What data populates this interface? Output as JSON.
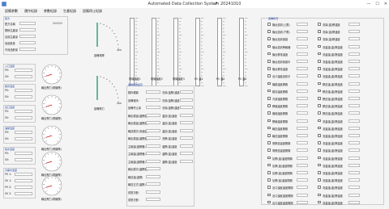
{
  "window": {
    "title": "Automated Data Collection System 20241010",
    "minimize": "—",
    "maximize": "☐",
    "close": "✕"
  },
  "menu": [
    {
      "label": "設備參數"
    },
    {
      "label": "運作紀錄"
    },
    {
      "label": "參數紀錄"
    },
    {
      "label": "生產紀錄"
    },
    {
      "label": "設備停止紀錄"
    }
  ],
  "top_group": {
    "title": "配方",
    "rows": [
      {
        "label": "配方名稱"
      },
      {
        "label": "累積生產量"
      },
      {
        "label": "目前生產量"
      },
      {
        "label": "良品數量"
      },
      {
        "label": "不良品數量"
      }
    ],
    "sample_value": "000000"
  },
  "left_groups": [
    {
      "title": "入口溫度",
      "rows": [
        {
          "label": "PV:"
        },
        {
          "label": "SV:"
        }
      ]
    },
    {
      "title": "模具溫度",
      "rows": [
        {
          "label": "PV:"
        },
        {
          "label": "SV:"
        }
      ]
    },
    {
      "title": "出口溫度",
      "rows": [
        {
          "label": "PV:"
        },
        {
          "label": "SV:"
        }
      ]
    },
    {
      "title": "油壓溫度",
      "rows": [
        {
          "label": "PV:"
        },
        {
          "label": "SV:"
        }
      ]
    },
    {
      "title": "噴水溫度",
      "rows": [
        {
          "label": "PV:"
        },
        {
          "label": "SV:"
        }
      ]
    },
    {
      "title": "冷卻水溫度",
      "rows": [
        {
          "label": "PV 1:"
        },
        {
          "label": "SV 1:"
        },
        {
          "label": "PV 2:"
        },
        {
          "label": "SV 2:"
        }
      ]
    }
  ],
  "gauges": [
    {
      "label": "輸出壓力(電機壓)",
      "level": 0.1
    },
    {
      "label": "輸出壓力(電機壓)",
      "level": 0.1
    },
    {
      "label": "輸出壓力(電機壓)",
      "level": 0.1
    },
    {
      "label": "輸出壓力(電機壓)",
      "level": 0.1
    },
    {
      "label": "輸出壓力(電機壓)",
      "level": 0.1
    }
  ],
  "dials": [
    {
      "label": "設備電壓",
      "max": "400"
    },
    {
      "label": "設備壓力",
      "max": "400"
    }
  ],
  "bars": [
    {
      "label": "電機溫度1"
    },
    {
      "label": "電機溫度2"
    },
    {
      "label": "電機溫度3"
    },
    {
      "label": "PV 溫1"
    },
    {
      "label": "PV 溫2"
    },
    {
      "label": "PV 溫3"
    }
  ],
  "params": {
    "title": "運轉參數設定",
    "left": [
      {
        "label": "模料種類"
      },
      {
        "label": "設備程序:"
      },
      {
        "label": "設備停止量"
      },
      {
        "label": "輸出模溫(溫壓器)"
      },
      {
        "label": "輸出模溫(溫壓器)"
      },
      {
        "label": "輸送模次(流速度)"
      },
      {
        "label": "輸出模溫(溫壓器)"
      },
      {
        "label": "主軸溫(溫壓器)"
      },
      {
        "label": "主軸溫(溫壓器)"
      },
      {
        "label": "主軸溫(溫壓器)"
      },
      {
        "label": "輸出模次(溫壓器)"
      },
      {
        "label": "輸送溫(溫壓)"
      },
      {
        "label": "輸送正式(溫壓)"
      },
      {
        "label": "成型次數："
      },
      {
        "label": "成型次數："
      }
    ],
    "right": [
      {
        "label": "去除(溫壓)溫度"
      },
      {
        "label": "去除(溫壓)溫度"
      },
      {
        "label": "去除(溫壓)溫度"
      },
      {
        "label": "溫送(溫)溫度"
      },
      {
        "label": "溫送(溫)溫度"
      },
      {
        "label": "溫送(溫)溫度"
      },
      {
        "label": "流壓(溫)溫度"
      },
      {
        "label": "溫壓(溫)溫度"
      },
      {
        "label": "溫壓(溫)溫度"
      },
      {
        "label": "溫壓(溫)溫度"
      }
    ]
  },
  "checks": {
    "title": "運轉狀況",
    "left": [
      {
        "label": "機台過熱(上限)"
      },
      {
        "label": "機台過熱(下限)"
      },
      {
        "label": "機台過熱保護"
      },
      {
        "label": "機台過熱警報器"
      },
      {
        "label": "機台異常溫度"
      },
      {
        "label": "機台過熱保護中"
      },
      {
        "label": "機台異常溫度"
      },
      {
        "label": "出口溫度過熱中"
      },
      {
        "label": "機模溫度開關"
      },
      {
        "label": "模具溫度開關"
      },
      {
        "label": "冷卻溫度開關"
      },
      {
        "label": "壓縮溫度開關"
      },
      {
        "label": "機械溫度開關"
      },
      {
        "label": "壓縮溫度開關"
      },
      {
        "label": "輸送溫度開關"
      },
      {
        "label": "輸送溫度開關"
      },
      {
        "label": "電壓過溫度開關"
      },
      {
        "label": "電壓過溫度開關"
      },
      {
        "label": "氣壓(溫)溫度開關"
      },
      {
        "label": "氣壓(溫)溫度開關"
      },
      {
        "label": "氣壓(溫)溫度開關"
      },
      {
        "label": "氣壓(溫)溫度開關"
      },
      {
        "label": "出口溫度溫度開關"
      },
      {
        "label": "出口溫度溫度開關"
      },
      {
        "label": "出口溫度溫度開關"
      }
    ],
    "right": [
      {
        "label": "流量(溫)壓溫度"
      },
      {
        "label": "流量(溫)壓溫度"
      },
      {
        "label": "流量(溫)壓溫度"
      },
      {
        "label": "流溫溫(溫)壓溫度"
      },
      {
        "label": "流溫溫(溫)壓溫度"
      },
      {
        "label": "流溫溫(溫)壓溫度"
      },
      {
        "label": "流溫溫(溫)壓溫度"
      },
      {
        "label": "流溫溫(溫)壓溫度"
      },
      {
        "label": "壓送溫(溫)壓溫度"
      },
      {
        "label": "壓送溫(溫)壓溫度"
      },
      {
        "label": "壓送溫(溫)壓溫度"
      },
      {
        "label": "壓送溫(溫)壓溫度"
      },
      {
        "label": "壓送溫(溫)壓溫度"
      },
      {
        "label": "流溫溫(溫)壓溫度"
      },
      {
        "label": "流溫溫(溫)壓溫度"
      },
      {
        "label": "流溫溫(溫)壓溫度"
      },
      {
        "label": "流溫溫(溫)壓溫度"
      },
      {
        "label": "流溫溫(溫)壓溫度"
      },
      {
        "label": "流溫溫(溫)壓溫度"
      },
      {
        "label": "流溫溫(溫)壓溫度"
      },
      {
        "label": "流溫溫(溫)壓溫度"
      },
      {
        "label": "流溫溫(溫)壓溫度"
      },
      {
        "label": "流溫溫(溫)壓溫度"
      },
      {
        "label": "流溫溫(溫)壓溫度"
      },
      {
        "label": "流溫溫(溫)壓溫度"
      }
    ]
  }
}
